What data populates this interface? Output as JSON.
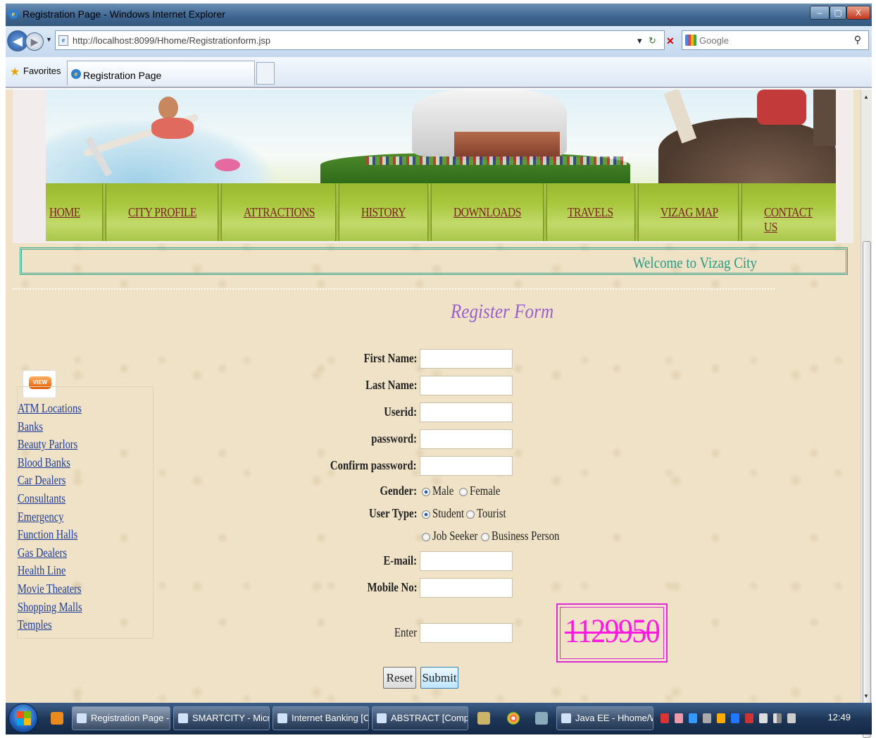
{
  "window": {
    "title": "Registration Page - Windows Internet Explorer",
    "btn_min": "–",
    "btn_max": "▢",
    "btn_close": "X"
  },
  "addressbar": {
    "url": "http://localhost:8099/Hhome/Registrationform.jsp",
    "search_placeholder": "Google"
  },
  "favorites": {
    "label": "Favorites",
    "tab_title": "Registration Page"
  },
  "nav": [
    "HOME",
    "CITY PROFILE",
    "ATTRACTIONS",
    "HISTORY",
    "DOWNLOADS",
    "TRAVELS",
    "VIZAG MAP",
    "CONTACT US"
  ],
  "welcome": "Welcome to Vizag City",
  "form": {
    "title": "Register Form",
    "first_name": "First Name:",
    "last_name": "Last Name:",
    "userid": "Userid:",
    "password": "password:",
    "confirm_password": "Confirm password:",
    "gender": "Gender:",
    "gender_options": [
      "Male",
      "Female"
    ],
    "gender_selected": "Male",
    "user_type": "User Type:",
    "user_type_options": [
      "Student",
      "Tourist",
      "Job Seeker",
      "Business Person"
    ],
    "user_type_selected": "Student",
    "email": "E-mail:",
    "mobile": "Mobile No:",
    "enter": "Enter",
    "captcha": "1129950",
    "reset": "Reset",
    "submit": "Submit"
  },
  "sidebar": {
    "badge": "VIEW",
    "links": [
      "ATM Locations",
      "Banks",
      "Beauty Parlors",
      "Blood Banks",
      "Car Dealers",
      "Consultants",
      "Emergency",
      "Function Halls",
      "Gas Dealers",
      "Health Line",
      "Movie Theaters",
      "Shopping Malls",
      "Temples"
    ]
  },
  "taskbar": {
    "items": [
      "Registration Page - ...",
      "SMARTCITY - Micro...",
      "Internet Banking [C...",
      "ABSTRACT [Compa...",
      "Java EE - Hhome/W..."
    ],
    "clock": "12:49"
  }
}
